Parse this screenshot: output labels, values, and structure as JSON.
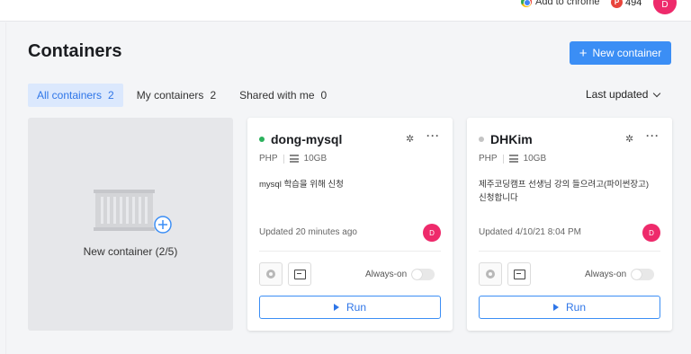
{
  "topbar": {
    "chrome_label": "Add to chrome",
    "points_icon": "P",
    "points": "494",
    "avatar_initial": "D"
  },
  "header": {
    "title": "Containers",
    "new_button_label": "New container"
  },
  "tabs": [
    {
      "label": "All containers",
      "count": "2",
      "active": true
    },
    {
      "label": "My containers",
      "count": "2",
      "active": false
    },
    {
      "label": "Shared with me",
      "count": "0",
      "active": false
    }
  ],
  "sort": {
    "label": "Last updated"
  },
  "new_card": {
    "label": "New container (2/5)"
  },
  "containers": [
    {
      "name": "dong-mysql",
      "status_color": "#2bb15c",
      "stack": "PHP",
      "disk": "10GB",
      "description": "mysql 학습을 위해 신청",
      "updated": "Updated 20 minutes ago",
      "user_initial": "D",
      "always_on_label": "Always-on",
      "run_label": "Run"
    },
    {
      "name": "DHKim",
      "status_color": "#c4c4c4",
      "stack": "PHP",
      "disk": "10GB",
      "description": "제주코딩캠프 선생님 강의 들으려고(파이썬장고) 신청합니다",
      "updated": "Updated 4/10/21 8:04 PM",
      "user_initial": "D",
      "always_on_label": "Always-on",
      "run_label": "Run"
    }
  ],
  "colors": {
    "accent": "#3b8ef5",
    "avatar": "#ee2a6b"
  }
}
